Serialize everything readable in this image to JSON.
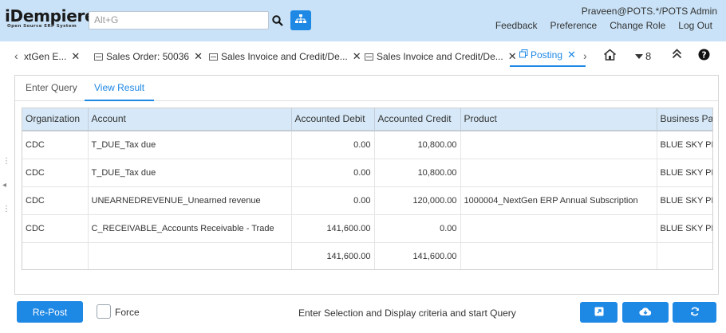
{
  "header": {
    "logo_main": "iDempiere",
    "logo_sub": "Open Source ERP System",
    "search_placeholder": "Alt+G",
    "user": "Praveen@POTS.*/POTS Admin",
    "links": [
      "Feedback",
      "Preference",
      "Change Role",
      "Log Out"
    ]
  },
  "tabs": {
    "items": [
      {
        "label": "xtGen E...",
        "icon": "none"
      },
      {
        "label": "Sales Order: 50036",
        "icon": "document-icon"
      },
      {
        "label": "Sales Invoice and Credit/De...",
        "icon": "document-icon"
      },
      {
        "label": "Sales Invoice and Credit/De...",
        "icon": "document-icon"
      },
      {
        "label": "Posting",
        "icon": "link-icon",
        "active": true
      }
    ],
    "window_count": "8"
  },
  "subtabs": [
    "Enter Query",
    "View Result"
  ],
  "grid": {
    "columns": [
      "Organization",
      "Account",
      "Accounted Debit",
      "Accounted Credit",
      "Product",
      "Business Partner"
    ],
    "rows": [
      [
        "CDC",
        "T_DUE_Tax due",
        "0.00",
        "10,800.00",
        "",
        "BLUE SKY PLUMBING"
      ],
      [
        "CDC",
        "T_DUE_Tax due",
        "0.00",
        "10,800.00",
        "",
        "BLUE SKY PLUMBING"
      ],
      [
        "CDC",
        "UNEARNEDREVENUE_Unearned revenue",
        "0.00",
        "120,000.00",
        "1000004_NextGen ERP Annual Subscription",
        "BLUE SKY PLUMBING"
      ],
      [
        "CDC",
        "C_RECEIVABLE_Accounts Receivable - Trade",
        "141,600.00",
        "0.00",
        "",
        "BLUE SKY PLUMBING"
      ],
      [
        "",
        "",
        "141,600.00",
        "141,600.00",
        "",
        ""
      ]
    ]
  },
  "footer": {
    "repost_label": "Re-Post",
    "force_label": "Force",
    "force_checked": false,
    "status": "Enter Selection and Display criteria and start Query"
  },
  "colors": {
    "header_bg": "#c9e2f7",
    "accent": "#1e88e5",
    "grid_header_bg": "#d7e9f8"
  }
}
